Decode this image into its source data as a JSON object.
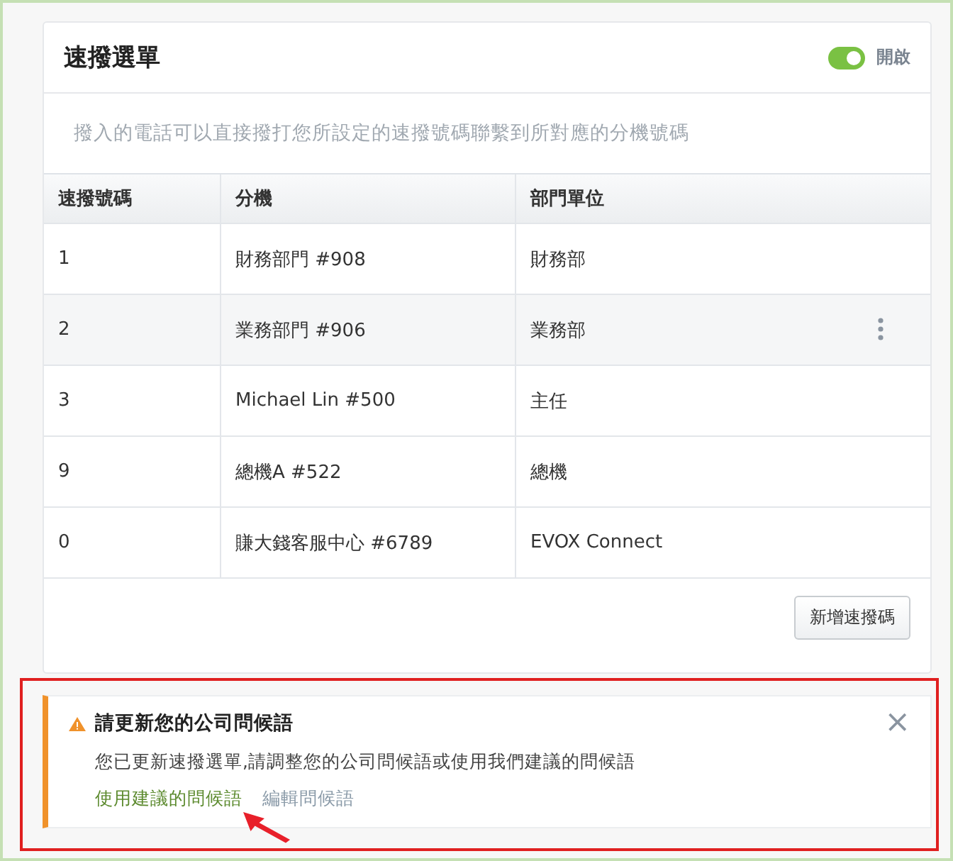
{
  "card": {
    "title": "速撥選單",
    "toggle": {
      "on": true,
      "label": "開啟"
    },
    "description": "撥入的電話可以直接撥打您所設定的速撥號碼聯繫到所對應的分機號碼"
  },
  "table": {
    "columns": [
      "速撥號碼",
      "分機",
      "部門單位"
    ],
    "rows": [
      {
        "cells": [
          "1",
          "財務部門 #908",
          "財務部"
        ],
        "highlighted": false
      },
      {
        "cells": [
          "2",
          "業務部門 #906",
          "業務部"
        ],
        "highlighted": true
      },
      {
        "cells": [
          "3",
          "Michael Lin #500",
          "主任"
        ],
        "highlighted": false
      },
      {
        "cells": [
          "9",
          "總機A  #522",
          "總機"
        ],
        "highlighted": false
      },
      {
        "cells": [
          "0",
          "賺大錢客服中心 #6789",
          "EVOX Connect"
        ],
        "highlighted": false
      }
    ]
  },
  "add_button": "新增速撥碼",
  "alert": {
    "title": "請更新您的公司問候語",
    "message": "您已更新速撥選單,請調整您的公司問候語或使用我們建議的問候語",
    "links": [
      {
        "label": "使用建議的問候語",
        "kind": "primary"
      },
      {
        "label": "編輯問候語",
        "kind": "secondary"
      }
    ],
    "close": "×"
  }
}
